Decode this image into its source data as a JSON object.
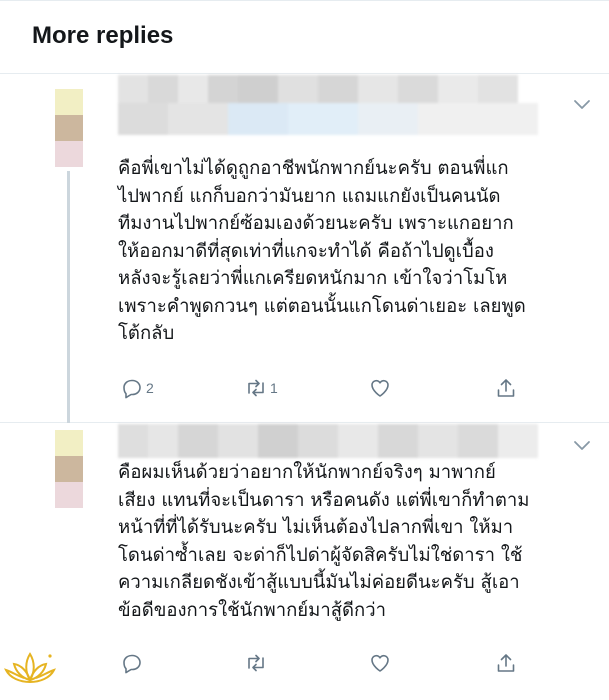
{
  "header": {
    "title": "More replies"
  },
  "replies": [
    {
      "text": "คือพี่เขาไม่ได้ดูถูกอาชีพนักพากย์นะครับ ตอนพี่แก\nไปพากย์ แกก็บอกว่ามันยาก แถมแกยังเป็นคนนัด\nทีมงานไปพากย์ซ้อมเองด้วยนะครับ เพราะแกอยาก\nให้ออกมาดีที่สุดเท่าที่แกจะทำได้ คือถ้าไปดูเบื้อง\nหลังจะรู้เลยว่าพี่แกเครียดหนักมาก เข้าใจว่าโมโห\nเพราะคำพูดกวนๆ แต่ตอนนั้นแกโดนด่าเยอะ เลยพูด\nโต้กลับ",
      "reply_count": "2",
      "retweet_count": "1",
      "like_count": ""
    },
    {
      "text": "คือผมเห็นด้วยว่าอยากให้นักพากย์จริงๆ มาพากย์\nเสียง แทนที่จะเป็นดารา หรือคนดัง แต่พี่เขาก็ทำตาม\nหน้าที่ที่ได้รับนะครับ ไม่เห็นต้องไปลากพี่เขา ให้มา\nโดนด่าซ้ำเลย จะด่าก็ไปด่าผู้จัดสิครับไม่ใช่ดารา ใช้\nความเกลียดชังเข้าสู้แบบนี้มันไม่ค่อยดีนะครับ สู้เอา\nข้อดีของการใช้นักพากย์มาสู้ดีกว่า",
      "reply_count": "",
      "retweet_count": "",
      "like_count": ""
    }
  ],
  "icons": {
    "reply": "reply-bubble-icon",
    "retweet": "retweet-icon",
    "like": "heart-icon",
    "share": "share-icon",
    "more": "chevron-down-icon",
    "watermark": "lotus-logo"
  },
  "colors": {
    "icon": "#657786",
    "text": "#14171a",
    "divider": "#e6ecf0",
    "thread_line": "#ccd6dd",
    "logo": "#e6b422"
  }
}
